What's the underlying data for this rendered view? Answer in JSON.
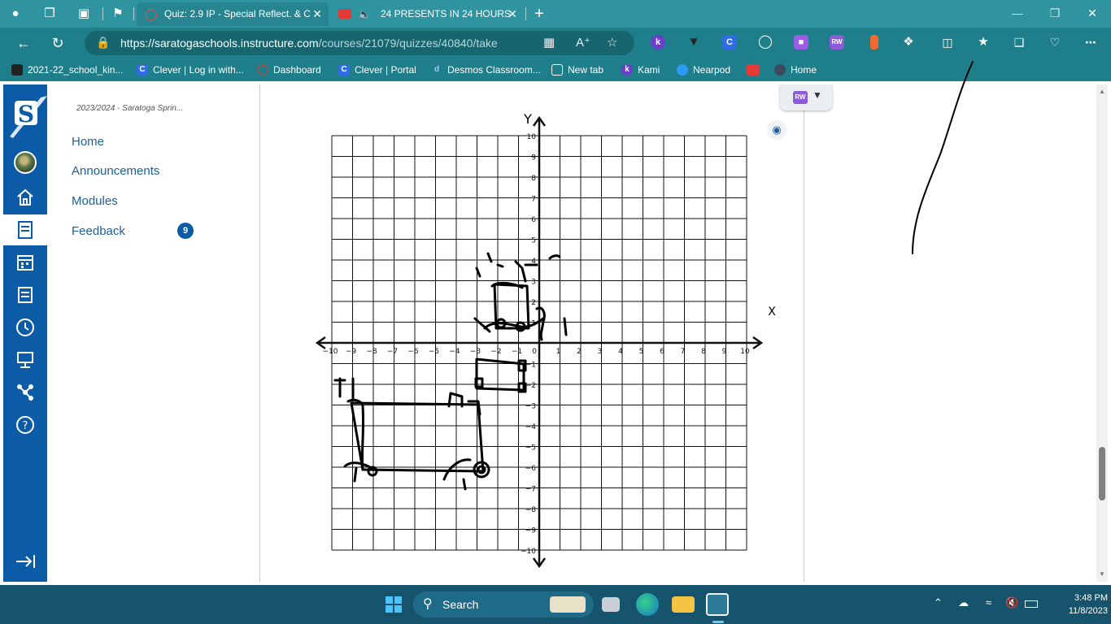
{
  "tabs": [
    {
      "title": "Quiz: 2.9 IP - Special Reflect. & C",
      "active": true
    },
    {
      "title": "24 PRESENTS IN 24 HOURS",
      "active": false
    }
  ],
  "address": {
    "host": "https://saratogaschools.instructure.com",
    "path": "/courses/21079/quizzes/40840/take"
  },
  "bookmarks": [
    "2021-22_school_kin...",
    "Clever | Log in with...",
    "Dashboard",
    "Clever | Portal",
    "Desmos Classroom...",
    "New tab",
    "Kami",
    "Nearpod",
    "",
    "Home"
  ],
  "sidebar": {
    "breadcrumb": "2023/2024 - Saratoga Sprin...",
    "items": [
      "Home",
      "Announcements",
      "Modules",
      "Feedback"
    ],
    "feedback_badge": "9"
  },
  "graph": {
    "x_label": "X",
    "y_label": "Y",
    "x_range": [
      -10,
      10
    ],
    "y_range": [
      -10,
      10
    ]
  },
  "extension_popup": {
    "badge": "RW"
  },
  "taskbar": {
    "search_label": "Search",
    "time": "3:48 PM",
    "date": "11/8/2023"
  },
  "colors": {
    "accent_teal": "#2f93a0",
    "canvas_blue": "#0b5ba6",
    "link_blue": "#1d5f9a"
  },
  "icons": [
    "back-icon",
    "refresh-icon",
    "lock-icon",
    "star-icon",
    "search-icon",
    "home-icon",
    "calendar-icon",
    "inbox-icon",
    "history-icon",
    "help-icon",
    "expand-icon"
  ]
}
